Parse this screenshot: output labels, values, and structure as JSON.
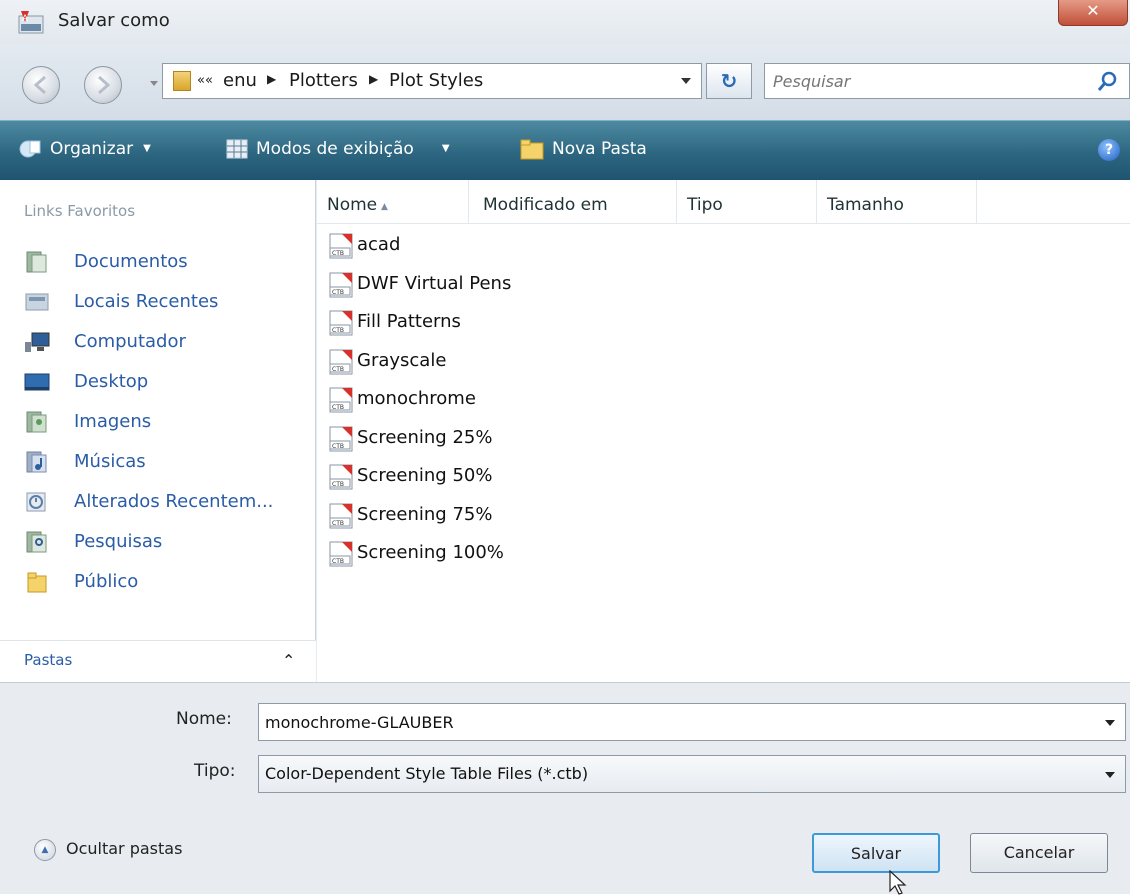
{
  "window": {
    "title": "Salvar como",
    "close_label": "✕"
  },
  "address": {
    "crumbs": [
      "enu",
      "Plotters",
      "Plot Styles"
    ],
    "overflow": "««"
  },
  "search": {
    "placeholder": "Pesquisar"
  },
  "toolbar": {
    "organize_label": "Organizar",
    "views_label": "Modos de exibição",
    "new_folder_label": "Nova Pasta",
    "help_label": "?"
  },
  "sidebar": {
    "header": "Links Favoritos",
    "items": [
      {
        "label": "Documentos",
        "icon": "documents-icon"
      },
      {
        "label": "Locais Recentes",
        "icon": "recent-places-icon"
      },
      {
        "label": "Computador",
        "icon": "computer-icon"
      },
      {
        "label": "Desktop",
        "icon": "desktop-icon"
      },
      {
        "label": "Imagens",
        "icon": "pictures-icon"
      },
      {
        "label": "Músicas",
        "icon": "music-icon"
      },
      {
        "label": "Alterados Recentem...",
        "icon": "recently-changed-icon"
      },
      {
        "label": "Pesquisas",
        "icon": "searches-icon"
      },
      {
        "label": "Público",
        "icon": "public-folder-icon"
      }
    ],
    "folders_label": "Pastas"
  },
  "filelist": {
    "columns": [
      "Nome",
      "Modificado em",
      "Tipo",
      "Tamanho"
    ],
    "files": [
      "acad",
      "DWF Virtual Pens",
      "Fill Patterns",
      "Grayscale",
      "monochrome",
      "Screening 25%",
      "Screening 50%",
      "Screening 75%",
      "Screening 100%"
    ],
    "file_icon_text": "CTB"
  },
  "form": {
    "name_label": "Nome:",
    "name_value": "monochrome-GLAUBER",
    "type_label": "Tipo:",
    "type_value": "Color-Dependent Style Table Files (*.ctb)",
    "hide_folders_label": "Ocultar pastas",
    "save_label": "Salvar",
    "cancel_label": "Cancelar"
  },
  "colors": {
    "toolbar": "#2d6680",
    "link_blue": "#2a5ca8",
    "close_red": "#c14f38",
    "save_border": "#3c9ad8"
  }
}
